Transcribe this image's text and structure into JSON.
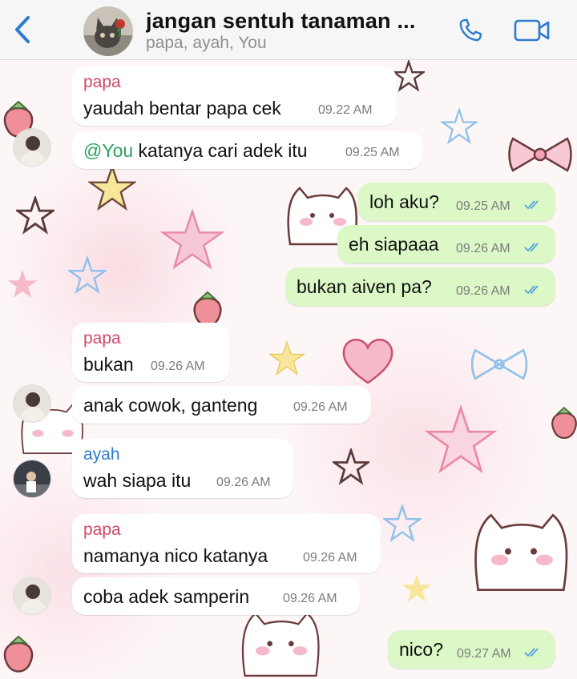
{
  "header": {
    "back_icon": "chevron-left-icon",
    "title": "jangan sentuh tanaman ...",
    "participants": "papa, ayah, You",
    "call_icon": "phone-icon",
    "video_icon": "video-camera-icon",
    "accent_color": "#2d7bd1"
  },
  "messages": [
    {
      "direction": "in",
      "sender": "papa",
      "text": "yaudah bentar papa cek",
      "time": "09.22 AM"
    },
    {
      "direction": "in",
      "mention": "@You",
      "text": " katanya cari adek itu",
      "time": "09.25 AM"
    },
    {
      "direction": "out",
      "text": "loh aku?",
      "time": "09.25 AM",
      "status": "read"
    },
    {
      "direction": "out",
      "text": "eh siapaaa",
      "time": "09.26 AM",
      "status": "read"
    },
    {
      "direction": "out",
      "text": "bukan aiven pa?",
      "time": "09.26 AM",
      "status": "read"
    },
    {
      "direction": "in",
      "sender": "papa",
      "text": "bukan",
      "time": "09.26 AM"
    },
    {
      "direction": "in",
      "text": "anak cowok, ganteng",
      "time": "09.26 AM"
    },
    {
      "direction": "in",
      "sender": "ayah",
      "text": "wah siapa itu",
      "time": "09.26 AM"
    },
    {
      "direction": "in",
      "sender": "papa",
      "text": "namanya nico katanya",
      "time": "09.26 AM"
    },
    {
      "direction": "in",
      "text": "coba adek samperin",
      "time": "09.26 AM"
    },
    {
      "direction": "out",
      "text": "nico?",
      "time": "09.27 AM",
      "status": "read"
    }
  ],
  "colors": {
    "outgoing_bubble": "#dcf8c6",
    "incoming_bubble": "#ffffff",
    "papa_name": "#d1476a",
    "ayah_name": "#2d7bd1",
    "mention": "#2aa25e",
    "read_ticks": "#4fa3e0"
  }
}
